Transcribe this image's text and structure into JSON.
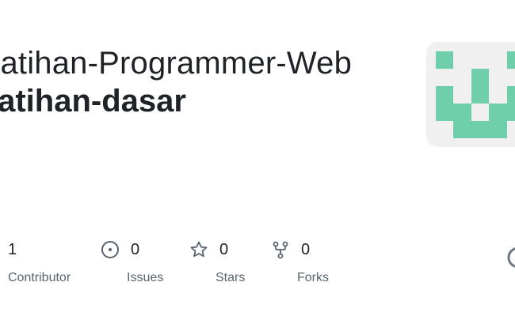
{
  "repo": {
    "owner": "Latihan-Programmer-Web",
    "name": "latihan-dasar"
  },
  "avatar": {
    "color": "#6fcfab",
    "background": "#f0f0f0"
  },
  "stats": {
    "contributors": {
      "value": "1",
      "label": "Contributor",
      "icon": "people-icon"
    },
    "issues": {
      "value": "0",
      "label": "Issues",
      "icon": "issue-icon"
    },
    "stars": {
      "value": "0",
      "label": "Stars",
      "icon": "star-icon"
    },
    "forks": {
      "value": "0",
      "label": "Forks",
      "icon": "fork-icon"
    }
  },
  "colors": {
    "text": "#1f2328",
    "muted": "#59636e"
  }
}
